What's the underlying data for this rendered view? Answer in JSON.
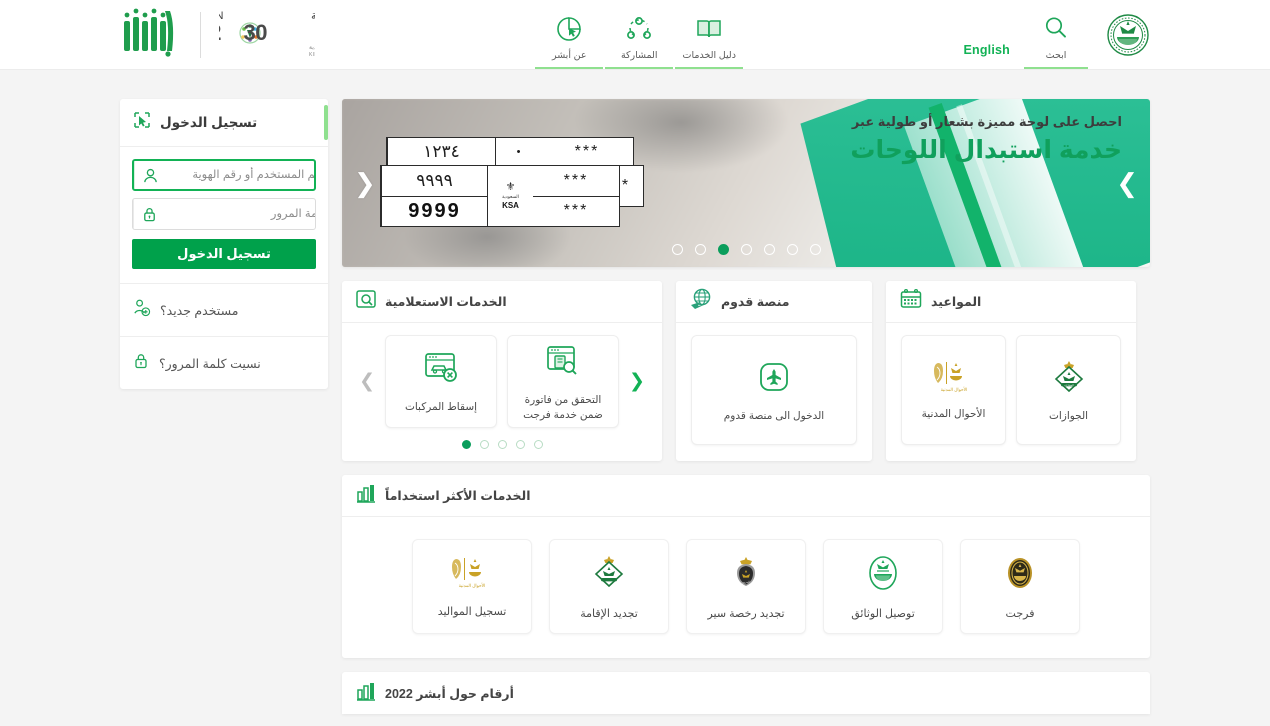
{
  "brand": {
    "accent_green": "#00a14b",
    "light_green": "#8fe08f",
    "teal": "#1fb98d",
    "absher_name": "أبشر",
    "vision_line1": "VISION",
    "vision_line1_ar": "رؤيــــة",
    "vision_year": "2030",
    "vision_sub_ar": "المملكة العربية السعودية",
    "vision_sub_en": "KINGDOM OF SAUDI ARABIA"
  },
  "header": {
    "search": {
      "label": "ابحث",
      "icon": "search-icon"
    },
    "language_link": "English",
    "nav": [
      {
        "label": "عن أبشر",
        "icon": "about-cursor-icon"
      },
      {
        "label": "المشاركة",
        "icon": "share-icon"
      },
      {
        "label": "دليل الخدمات",
        "icon": "book-icon"
      }
    ],
    "emblem_alt": "moi-emblem"
  },
  "login": {
    "title": "تسجيل الدخول",
    "title_icon": "login-cursor-icon",
    "username": {
      "placeholder": "اسم المستخدم أو رقم الهوية",
      "value": "",
      "icon": "user-icon",
      "focused": true
    },
    "password": {
      "placeholder": "كلمة المرور",
      "value": "",
      "icon": "lock-icon",
      "focused": false
    },
    "submit_label": "تسجيل الدخول",
    "links": [
      {
        "label": "مستخدم جديد؟",
        "icon": "add-user-icon"
      },
      {
        "label": "نسيت كلمة المرور؟",
        "icon": "lock-question-icon"
      }
    ]
  },
  "banner": {
    "subtitle": "احصل على لوحة مميزة بشعار أو طولية عبر",
    "title": "خدمة استبدال اللوحات",
    "plate": {
      "arabic_numerals_top": "١٢٣٤",
      "arabic_numerals_mid": "٩٩٩٩",
      "latin_numerals": "9999",
      "letters_top": "***",
      "letters_mid": "***",
      "letters_bottom": "***",
      "letter_side": "*",
      "small_letters": "•",
      "ksa_arabic": "السعودية",
      "ksa_latin": "KSA"
    },
    "dots_total": 7,
    "dots_active_index": 4,
    "prev_icon": "chevron-left-icon",
    "next_icon": "chevron-right-icon"
  },
  "cards": [
    {
      "title": "الخدمات الاستعلامية",
      "icon": "inquiry-search-icon",
      "tiles": [
        {
          "label": "إسقاط المركبات",
          "icon": "vehicle-scrap-icon"
        },
        {
          "label": "التحقق من فاتورة ضمن خدمة فرجت",
          "icon": "invoice-check-icon"
        }
      ],
      "prev_icon": "chevron-right-icon",
      "next_icon": "chevron-left-icon",
      "dots_total": 5,
      "dots_active_index": 4
    },
    {
      "title": "منصة قدوم",
      "icon": "globe-plane-icon",
      "tiles": [
        {
          "label": "الدخول الى منصة قدوم",
          "icon": "airplane-rounded-icon"
        }
      ]
    },
    {
      "title": "المواعيد",
      "icon": "calendar-icon",
      "tiles": [
        {
          "label": "الأحوال المدنية",
          "icon": "civil-affairs-logo"
        },
        {
          "label": "الجوازات",
          "icon": "passports-logo"
        }
      ]
    }
  ],
  "most_used": {
    "title": "الخدمات الأكثر استخداماً",
    "icon": "bar-chart-icon",
    "items": [
      {
        "label": "تسجيل المواليد",
        "icon": "civil-affairs-logo"
      },
      {
        "label": "تجديد الإقامة",
        "icon": "passports-logo"
      },
      {
        "label": "تجديد رخصة سير",
        "icon": "traffic-logo"
      },
      {
        "label": "توصيل الوثائق",
        "icon": "moi-green-logo"
      },
      {
        "label": "فرجت",
        "icon": "farjat-logo"
      }
    ]
  },
  "stats": {
    "title": "أرقام حول أبشر 2022",
    "icon": "bar-chart-icon"
  }
}
